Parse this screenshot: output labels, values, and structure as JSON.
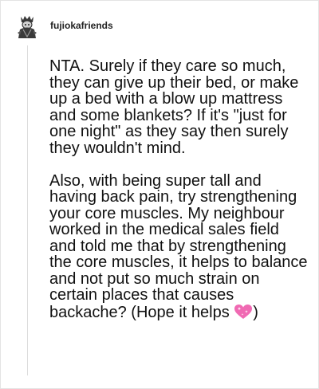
{
  "post": {
    "username": "fujiokafriends",
    "avatar_icon": "gothic-figure-avatar-icon",
    "paragraphs": [
      "NTA. Surely if they care so much, they can give up their bed, or make up a bed with a blow up mattress and some blankets? If it's \"just for one night\" as they say then surely they wouldn't mind.",
      "Also, with being super tall and having back pain, try strengthening your core muscles. My neighbour worked in the medical sales field and told me that by strengthening the core muscles, it helps to balance and not put so much strain on certain places that causes backache? (Hope it helps"
    ],
    "closing_paren": ")",
    "emoji_icon": "sparkling-heart-icon",
    "colors": {
      "text": "#111111",
      "heart": "#f06ab3",
      "thread_line": "#dcdcdc"
    }
  }
}
